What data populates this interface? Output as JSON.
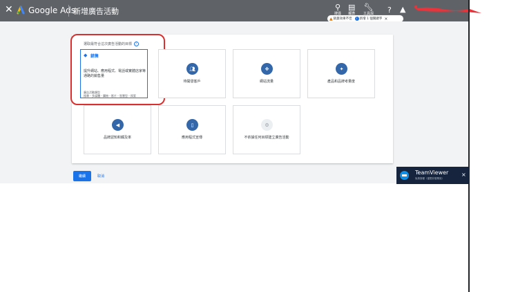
{
  "header": {
    "close_icon": "close-icon",
    "brand": "Google Ads",
    "page_title": "新增廣告活動",
    "tools": [
      {
        "icon": "search-icon",
        "label": "搜尋"
      },
      {
        "icon": "report-icon",
        "label": "報表"
      },
      {
        "icon": "wrench-icon",
        "label": "工具與"
      },
      {
        "icon": "help-icon",
        "label": ""
      },
      {
        "icon": "bell-icon",
        "label": ""
      }
    ],
    "notice": {
      "warning": "銷貨效果不佳",
      "info": "新增 1 個關鍵字",
      "close": "×"
    }
  },
  "main": {
    "instruction": "選取最符合這次廣告活動的目標",
    "selected_card": {
      "title": "銷售",
      "description": "提升網站、應用程式、電話或實體店家等通路的銷售量",
      "subtitle": "廣告活動類型",
      "types": "搜尋・多媒體・購物・影片・智慧型・探索"
    },
    "goals": [
      {
        "icon": "people-icon",
        "label": "待開發客戶"
      },
      {
        "icon": "cursor-icon",
        "label": "網站流量"
      },
      {
        "icon": "sparkle-icon",
        "label": "產品和品牌考量度"
      },
      {
        "icon": "megaphone-icon",
        "label": "品牌認知和觸及率"
      },
      {
        "icon": "phone-icon",
        "label": "應用程式宣傳"
      },
      {
        "icon": "gear-icon",
        "label": "不依據任何目標建立廣告活動"
      }
    ],
    "continue_label": "繼續",
    "cancel_label": "取消"
  },
  "teamviewer": {
    "name": "TeamViewer",
    "subtitle": "免費授權（僅限非營業用）",
    "close": "×"
  },
  "colors": {
    "topbar": "#5f6368",
    "accent": "#1a73e8",
    "icon_circle": "#3367a9",
    "highlight": "#d9302f",
    "teamviewer_bg": "#16253d"
  }
}
